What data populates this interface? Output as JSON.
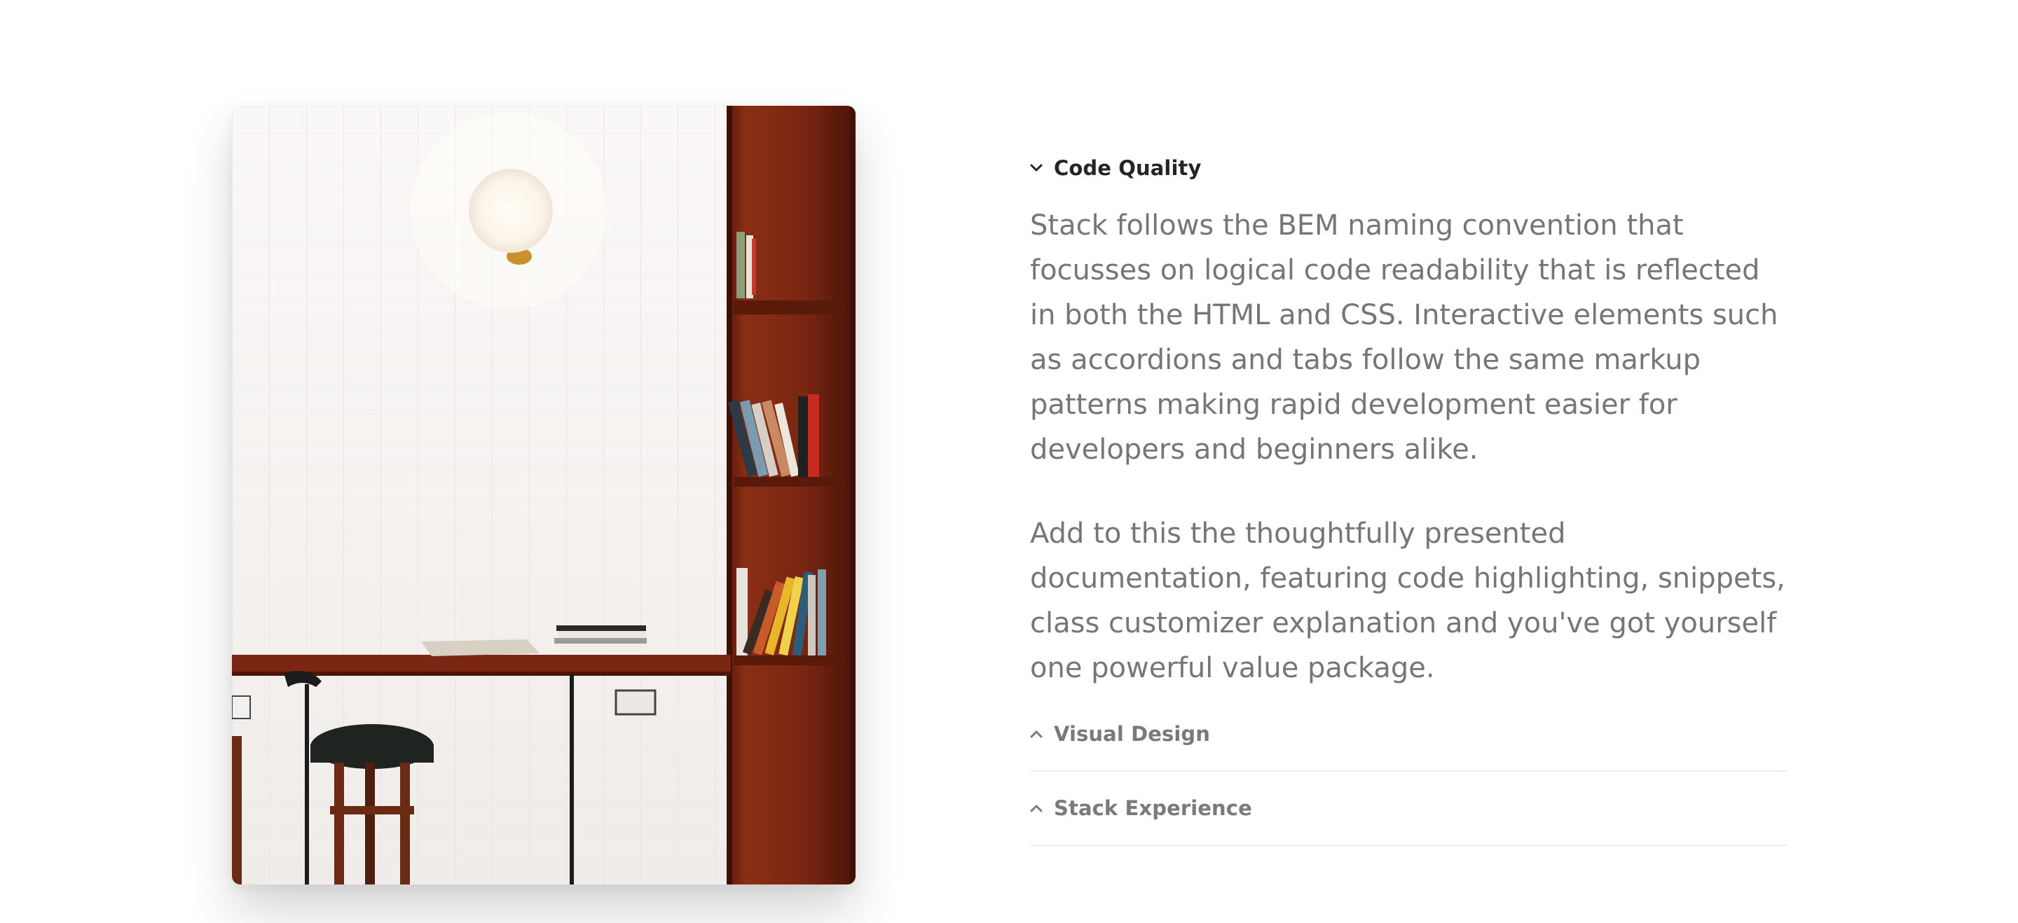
{
  "accordion": {
    "items": [
      {
        "title": "Code Quality",
        "expanded": true,
        "paragraphs": [
          "Stack follows the BEM naming convention that focusses on logical code readability that is reflected in both the HTML and CSS. Interactive elements such as accordions and tabs follow the same markup patterns making rapid development easier for developers and beginners alike.",
          "Add to this the thoughtfully presented documentation, featuring code highlighting, snippets, class customizer explanation and you've got yourself one powerful value package."
        ]
      },
      {
        "title": "Visual Design",
        "expanded": false
      },
      {
        "title": "Stack Experience",
        "expanded": false
      }
    ],
    "icons": {
      "expanded": "chevron-down-icon",
      "collapsed": "chevron-up-icon"
    }
  },
  "colors": {
    "text_active": "#252525",
    "text_muted": "#767676",
    "divider": "#eceff2",
    "wood": "#7a2612"
  }
}
